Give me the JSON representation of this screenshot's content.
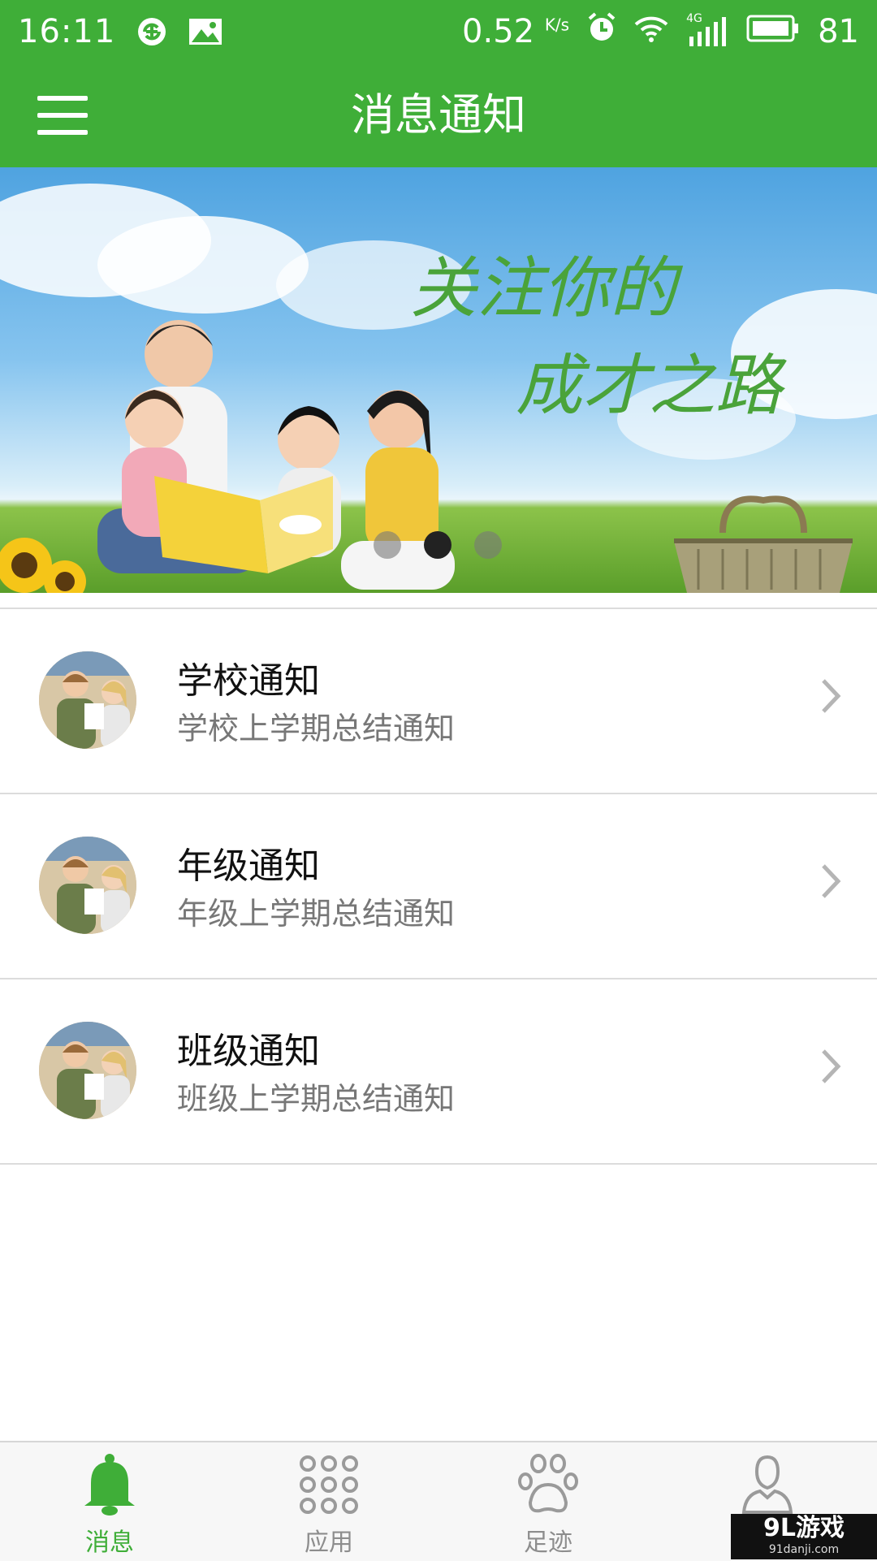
{
  "status_bar": {
    "time": "16:11",
    "speed": "0.52",
    "speed_unit": "K/s",
    "network": "4G",
    "battery": "81"
  },
  "app_bar": {
    "title": "消息通知"
  },
  "banner": {
    "slogan_line1": "关注你的",
    "slogan_line2": "成才之路",
    "active_dot": 2,
    "dot_count": 3
  },
  "notifications": [
    {
      "title": "学校通知",
      "subtitle": "学校上学期总结通知"
    },
    {
      "title": "年级通知",
      "subtitle": "年级上学期总结通知"
    },
    {
      "title": "班级通知",
      "subtitle": "班级上学期总结通知"
    }
  ],
  "bottom_nav": {
    "items": [
      {
        "label": "消息",
        "icon": "bell-icon",
        "active": true
      },
      {
        "label": "应用",
        "icon": "apps-grid-icon",
        "active": false
      },
      {
        "label": "足迹",
        "icon": "paw-icon",
        "active": false
      },
      {
        "label": "",
        "icon": "person-icon",
        "active": false
      }
    ]
  },
  "watermark": {
    "brand": "9L游戏",
    "site": "91danji.com"
  },
  "colors": {
    "primary": "#3fae38",
    "text_primary": "#111111",
    "text_secondary": "#777777",
    "nav_inactive": "#8d8d8d"
  }
}
